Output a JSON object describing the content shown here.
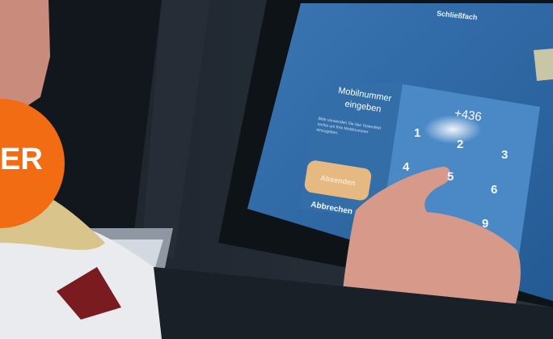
{
  "screen": {
    "title": "Schließfach",
    "panel_title": "Mobilnummer eingeben",
    "panel_hint": "Bitte verwenden Sie das Tastenfeld rechts um Ihre Mobilnummer einzugeben.",
    "send_button": "Absenden",
    "cancel_button": "Abbrechen",
    "phone_value": "+436",
    "keys": [
      "1",
      "2",
      "3",
      "4",
      "5",
      "6",
      "9"
    ]
  },
  "badge": {
    "text": "ER",
    "color": "#f26c13"
  },
  "colors": {
    "screen_blue": "#2f6aa6",
    "panel_blue": "#3e7dbb",
    "send_button": "#e6b983"
  }
}
